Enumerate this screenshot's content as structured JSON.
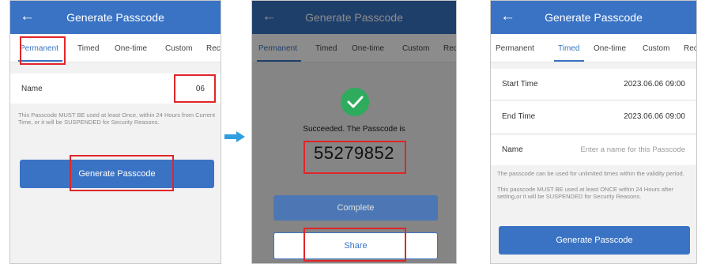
{
  "colors": {
    "primary": "#3a73c4",
    "highlight": "#e0262a",
    "success": "#2eab5c",
    "arrow": "#2f9fe0"
  },
  "screen1": {
    "title": "Generate Passcode",
    "back_icon": "back-arrow-icon",
    "tabs": [
      "Permanent",
      "Timed",
      "One-time",
      "Custom",
      "Rec"
    ],
    "name_label": "Name",
    "name_value": "06",
    "note": "This Passcode MUST BE used at least Once, within 24 Hours from Current Time, or it will be SUSPENDED for Security Reasons.",
    "button": "Generate Passcode"
  },
  "screen2": {
    "title": "Generate Passcode",
    "back_icon": "back-arrow-icon",
    "tabs": [
      "Permanent",
      "Timed",
      "One-time",
      "Custom",
      "Rec"
    ],
    "success_icon": "check-circle-icon",
    "message": "Succeeded. The Passcode is",
    "passcode": "55279852",
    "complete_button": "Complete",
    "share_button": "Share"
  },
  "screen3": {
    "title": "Generate Passcode",
    "back_icon": "back-arrow-icon",
    "tabs": [
      "Permanent",
      "Timed",
      "One-time",
      "Custom",
      "Rec"
    ],
    "start_label": "Start Time",
    "start_value": "2023.06.06 09:00",
    "end_label": "End Time",
    "end_value": "2023.06.06 09:00",
    "name_label": "Name",
    "name_placeholder": "Enter a name for this Passcode",
    "note_1": "The passcode can be used for unlimited times within the validity period.",
    "note_2": "This passcode MUST BE used at least ONCE within 24 Hours after setting,or it will be SUSPENDED for Security Reasons.",
    "button": "Generate Passcode"
  },
  "transition_icon": "right-arrow-icon"
}
